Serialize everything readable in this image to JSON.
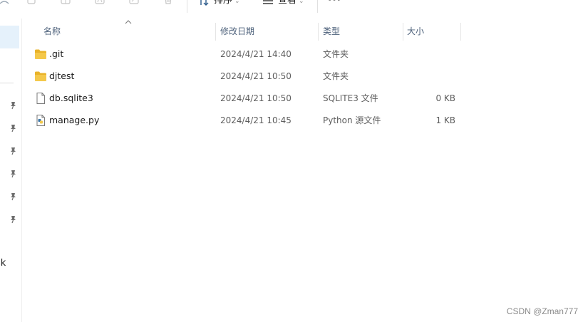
{
  "toolbar": {
    "sort_label": "排序",
    "view_label": "查看",
    "more_label": "···"
  },
  "headers": {
    "name": "名称",
    "date_modified": "修改日期",
    "type": "类型",
    "size": "大小"
  },
  "files": [
    {
      "name": ".git",
      "date": "2024/4/21 14:40",
      "type": "文件夹",
      "size": "",
      "icon": "folder-icon"
    },
    {
      "name": "djtest",
      "date": "2024/4/21 10:50",
      "type": "文件夹",
      "size": "",
      "icon": "folder-icon"
    },
    {
      "name": "db.sqlite3",
      "date": "2024/4/21 10:50",
      "type": "SQLITE3 文件",
      "size": "0 KB",
      "icon": "file-icon"
    },
    {
      "name": "manage.py",
      "date": "2024/4/21 10:45",
      "type": "Python 源文件",
      "size": "1 KB",
      "icon": "python-file-icon"
    }
  ],
  "nav": {
    "clipped_label": "sk"
  },
  "watermark": "CSDN @Zman777",
  "colors": {
    "folder": "#f4c542",
    "header_text": "#4c607a",
    "selection": "#e5f1fb"
  }
}
